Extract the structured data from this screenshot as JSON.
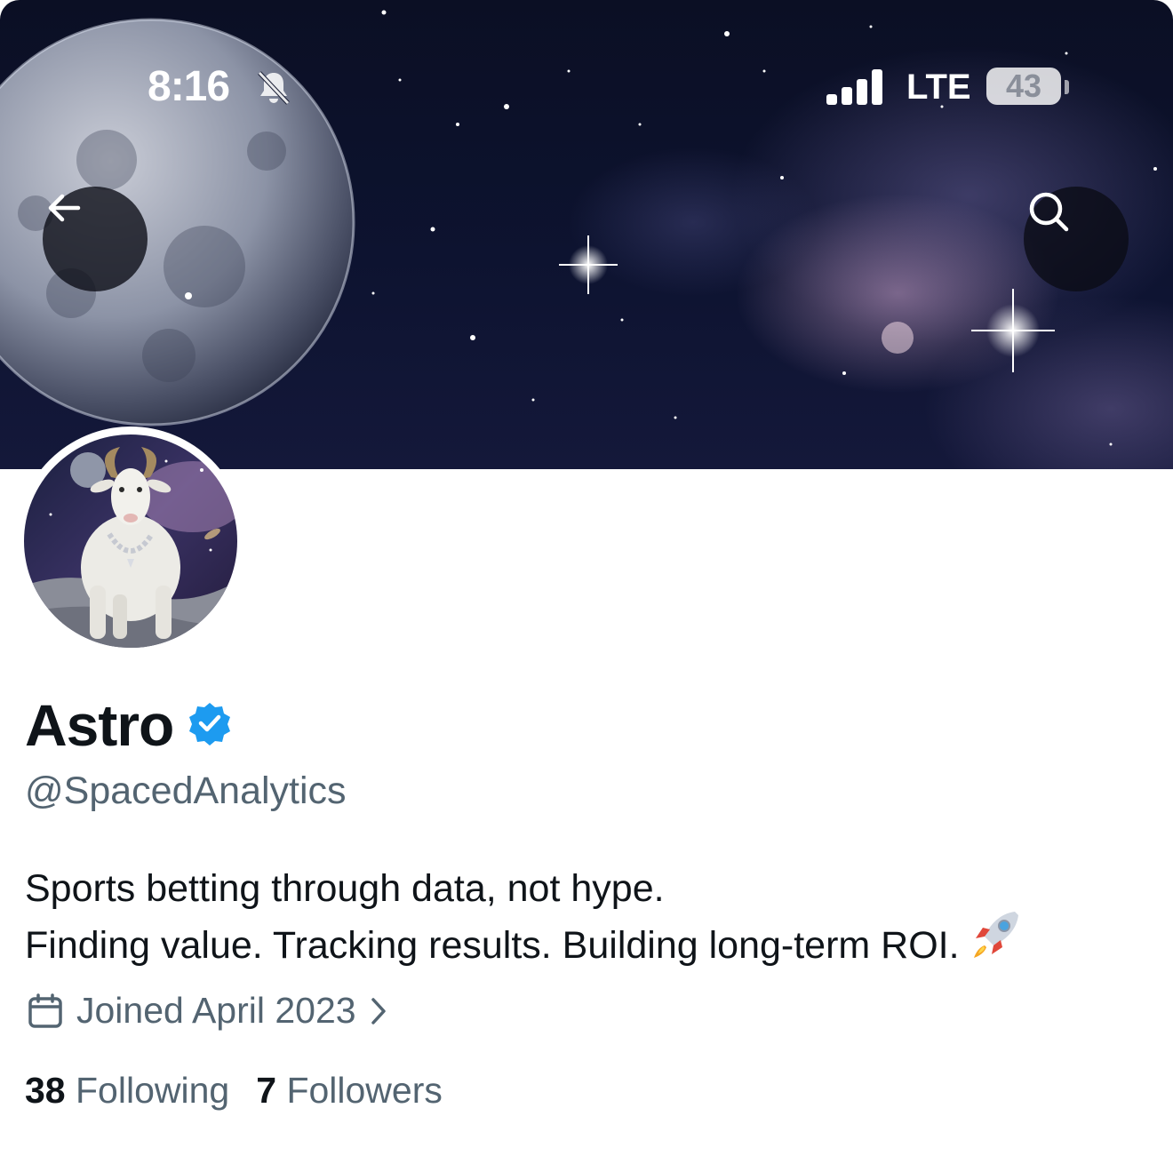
{
  "status_bar": {
    "time": "8:16",
    "network": "LTE",
    "battery": "43",
    "icons": [
      "bell-slash-icon",
      "signal-bars-icon",
      "battery-icon"
    ]
  },
  "header": {
    "back_icon": "arrow-left-icon",
    "search_icon": "search-icon"
  },
  "profile": {
    "display_name": "Astro",
    "verified_icon": "verified-badge-icon",
    "handle": "@SpacedAnalytics",
    "bio_line1": "Sports betting through data, not hype.",
    "bio_line2": "Finding value. Tracking results. Building long-term ROI.",
    "bio_emoji_icon": "rocket-icon",
    "joined": "Joined April 2023",
    "joined_icon": "calendar-icon",
    "following_count": "38",
    "following_label": "Following",
    "followers_count": "7",
    "followers_label": "Followers"
  },
  "colors": {
    "text_primary": "#0f1419",
    "text_secondary": "#536471",
    "verified_blue": "#1d9bf0"
  }
}
